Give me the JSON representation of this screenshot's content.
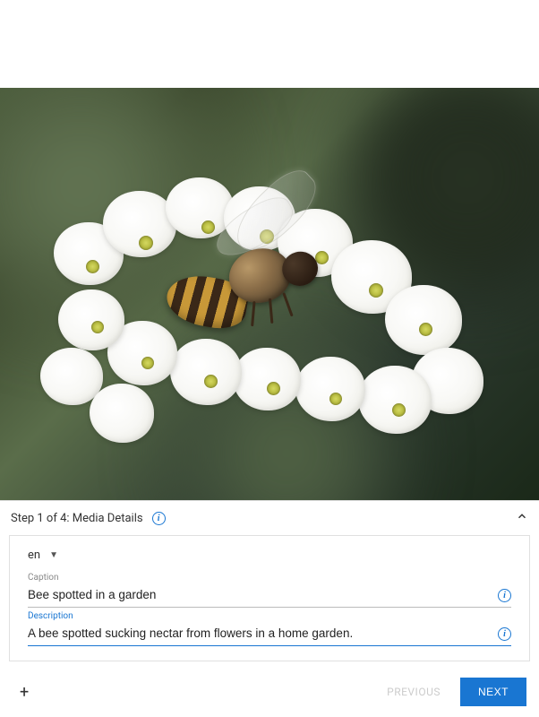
{
  "step": {
    "label": "Step 1 of 4: Media Details"
  },
  "language": {
    "selected": "en"
  },
  "caption": {
    "label": "Caption",
    "value": "Bee spotted in a garden"
  },
  "description": {
    "label": "Description",
    "value": "A bee spotted sucking nectar from flowers in a home garden."
  },
  "buttons": {
    "previous": "PREVIOUS",
    "next": "NEXT",
    "add": "+"
  },
  "image": {
    "alt": "Close-up photograph of a honeybee on white flowers"
  }
}
